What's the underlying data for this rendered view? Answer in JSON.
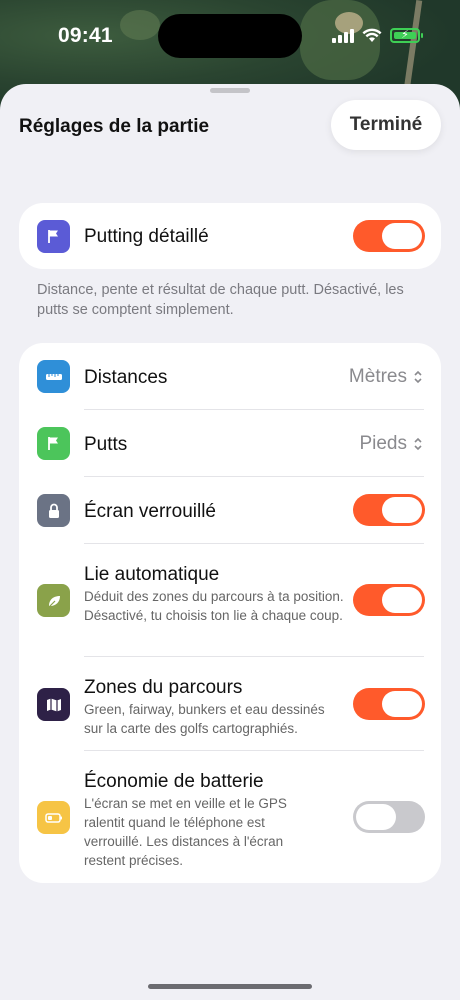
{
  "status_bar": {
    "time": "09:41"
  },
  "sheet": {
    "title": "Réglages de la partie",
    "done_label": "Terminé"
  },
  "putting": {
    "label": "Putting détaillé",
    "enabled": true,
    "icon": "flag-icon",
    "icon_color": "#5b5bd6",
    "note": "Distance, pente et résultat de chaque putt. Désactivé, les putts se comptent simplement."
  },
  "settings": {
    "distances": {
      "label": "Distances",
      "value": "Mètres",
      "icon": "ruler-icon",
      "icon_color": "#2f8fd8"
    },
    "putts": {
      "label": "Putts",
      "value": "Pieds",
      "icon": "flag-icon",
      "icon_color": "#4cc55b"
    },
    "lock_screen": {
      "label": "Écran verrouillé",
      "enabled": true,
      "icon": "lock-icon",
      "icon_color": "#6b7385"
    },
    "auto_lie": {
      "label": "Lie automatique",
      "description": "Déduit des zones du parcours à ta position. Désactivé, tu choisis ton lie à chaque coup.",
      "enabled": true,
      "icon": "leaf-icon",
      "icon_color": "#8aa24a"
    },
    "course_zones": {
      "label": "Zones du parcours",
      "description": "Green, fairway, bunkers et eau dessinés sur la carte des golfs cartographiés.",
      "enabled": true,
      "icon": "map-icon",
      "icon_color": "#2e2147"
    },
    "battery_saver": {
      "label": "Économie de batterie",
      "description": "L'écran se met en veille et le GPS ralentit quand le téléphone est verrouillé. Les distances à l'écran restent précises.",
      "enabled": false,
      "icon": "battery-icon",
      "icon_color": "#f6c445"
    }
  },
  "colors": {
    "accent": "#ff5a2b",
    "toggle_off": "#c9c9cd",
    "sheet_bg": "#f0f0f5"
  }
}
